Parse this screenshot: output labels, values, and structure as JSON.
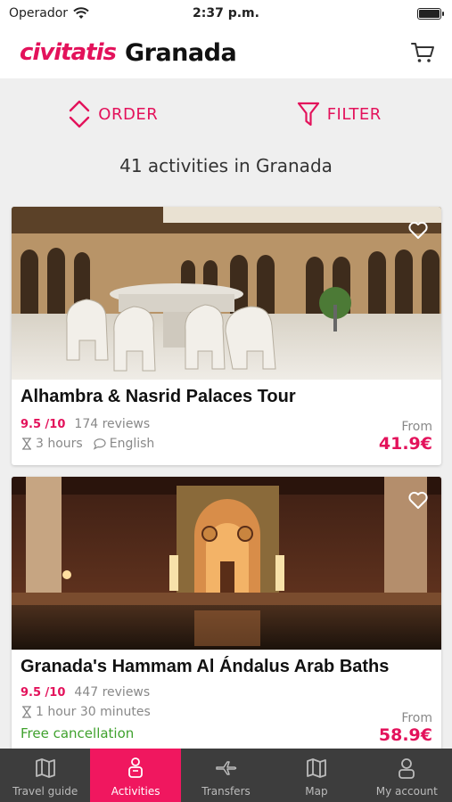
{
  "status": {
    "carrier": "Operador",
    "time": "2:37 p.m."
  },
  "header": {
    "brand": "civitatis",
    "city": "Granada"
  },
  "toolbar": {
    "order_label": "ORDER",
    "filter_label": "FILTER"
  },
  "results": {
    "count_text": "41 activities in Granada"
  },
  "activities": [
    {
      "title": "Alhambra & Nasrid Palaces Tour",
      "rating": "9.5 /10",
      "reviews": "174 reviews",
      "duration": "3 hours",
      "language": "English",
      "from_label": "From",
      "price": "41.9€"
    },
    {
      "title": "Granada's Hammam Al Ándalus Arab Baths",
      "rating": "9.5 /10",
      "reviews": "447 reviews",
      "duration": "1 hour 30 minutes",
      "free_cancellation": "Free cancellation",
      "from_label": "From",
      "price": "58.9€"
    }
  ],
  "tabs": [
    {
      "label": "Travel guide"
    },
    {
      "label": "Activities"
    },
    {
      "label": "Transfers"
    },
    {
      "label": "Map"
    },
    {
      "label": "My account"
    }
  ],
  "colors": {
    "accent": "#e3125b",
    "active_tab": "#f0175f",
    "tabbar": "#3d3d3d",
    "free": "#3fa12d"
  }
}
